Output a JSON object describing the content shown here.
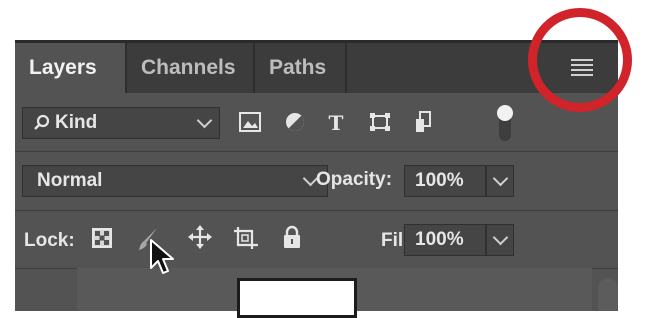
{
  "tabs": [
    {
      "label": "Layers",
      "active": true
    },
    {
      "label": "Channels",
      "active": false
    },
    {
      "label": "Paths",
      "active": false
    }
  ],
  "filter": {
    "label": "Kind",
    "icons": [
      "image-filter-icon",
      "adjustment-filter-icon",
      "type-filter-icon",
      "shape-filter-icon",
      "smart-object-filter-icon",
      "filter-toggle-icon"
    ]
  },
  "blend": {
    "mode": "Normal",
    "opacity_label": "Opacity:",
    "opacity_value": "100%"
  },
  "lock": {
    "label": "Lock:",
    "icons": [
      "lock-transparent-pixels-icon",
      "lock-image-pixels-icon",
      "lock-position-icon",
      "prevent-auto-nest-icon",
      "lock-all-icon"
    ],
    "fill_label": "Fill:",
    "fill_value": "100%"
  },
  "colors": {
    "highlight_circle": "#d1232a",
    "panel_bg": "#535353",
    "tabbar_bg": "#3c3c3c"
  }
}
